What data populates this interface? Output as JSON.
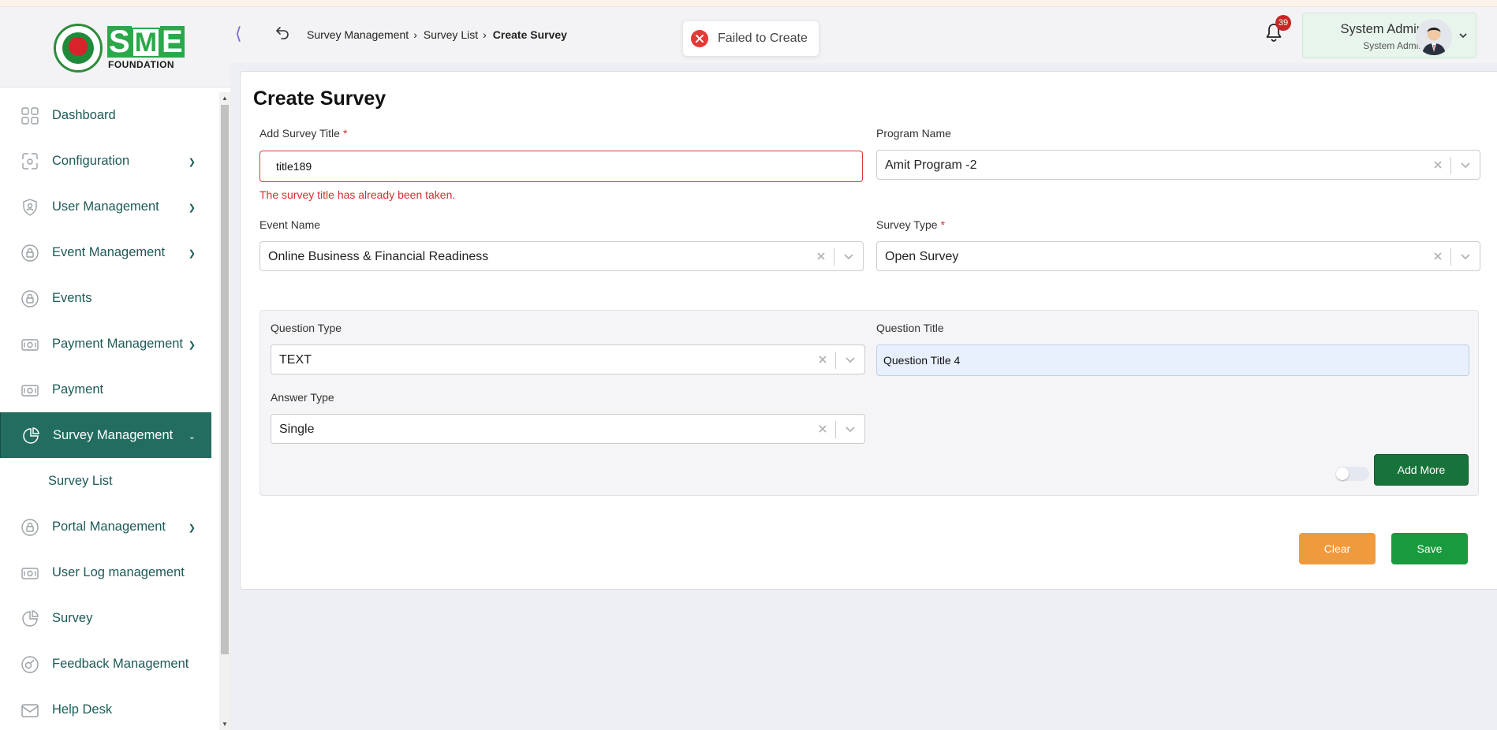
{
  "logo": {
    "wordmark": "FOUNDATION",
    "letters": [
      "S",
      "M",
      "E"
    ]
  },
  "sidebar": {
    "items": [
      {
        "label": "Dashboard",
        "icon": "grid-icon",
        "has_children": false
      },
      {
        "label": "Configuration",
        "icon": "config-icon",
        "has_children": true
      },
      {
        "label": "User Management",
        "icon": "shield-user-icon",
        "has_children": true
      },
      {
        "label": "Event Management",
        "icon": "lock-icon",
        "has_children": true
      },
      {
        "label": "Events",
        "icon": "lock-icon",
        "has_children": false
      },
      {
        "label": "Payment Management",
        "icon": "payment-icon",
        "has_children": true
      },
      {
        "label": "Payment",
        "icon": "payment-icon",
        "has_children": false
      },
      {
        "label": "Survey Management",
        "icon": "pie-chart-icon",
        "has_children": true,
        "active": true
      },
      {
        "label": "Portal Management",
        "icon": "lock-icon",
        "has_children": true
      },
      {
        "label": "User Log management",
        "icon": "payment-icon",
        "has_children": false
      },
      {
        "label": "Survey",
        "icon": "pie-chart-icon",
        "has_children": false
      },
      {
        "label": "Feedback Management",
        "icon": "feedback-icon",
        "has_children": false
      },
      {
        "label": "Help Desk",
        "icon": "mail-icon",
        "has_children": false
      }
    ],
    "subitem": "Survey List"
  },
  "header": {
    "breadcrumb": [
      "Survey Management",
      "Survey List",
      "Create Survey"
    ],
    "toast": "Failed to Create",
    "notifications": "39",
    "user_name": "System Admin",
    "user_role": "System Admin"
  },
  "form": {
    "title": "Create Survey",
    "survey_title_label": "Add Survey Title",
    "survey_title_value": "title189",
    "survey_title_error": "The survey title has already been taken.",
    "program_label": "Program Name",
    "program_value": "Amit Program -2",
    "event_label": "Event Name",
    "event_value": "Online Business & Financial Readiness",
    "survey_type_label": "Survey Type",
    "survey_type_value": "Open Survey",
    "required_mark": "*"
  },
  "question": {
    "type_label": "Question Type",
    "type_value": "TEXT",
    "title_label": "Question Title",
    "title_value": "Question Title 4",
    "answer_label": "Answer Type",
    "answer_value": "Single",
    "add_more": "Add More"
  },
  "actions": {
    "clear": "Clear",
    "save": "Save"
  },
  "colors": {
    "sidebar_active": "#226c60",
    "nav_text": "#1c5a56",
    "error": "#d32f2f",
    "add_more": "#17733a",
    "clear": "#f09a3e",
    "save": "#1a9a3e"
  }
}
